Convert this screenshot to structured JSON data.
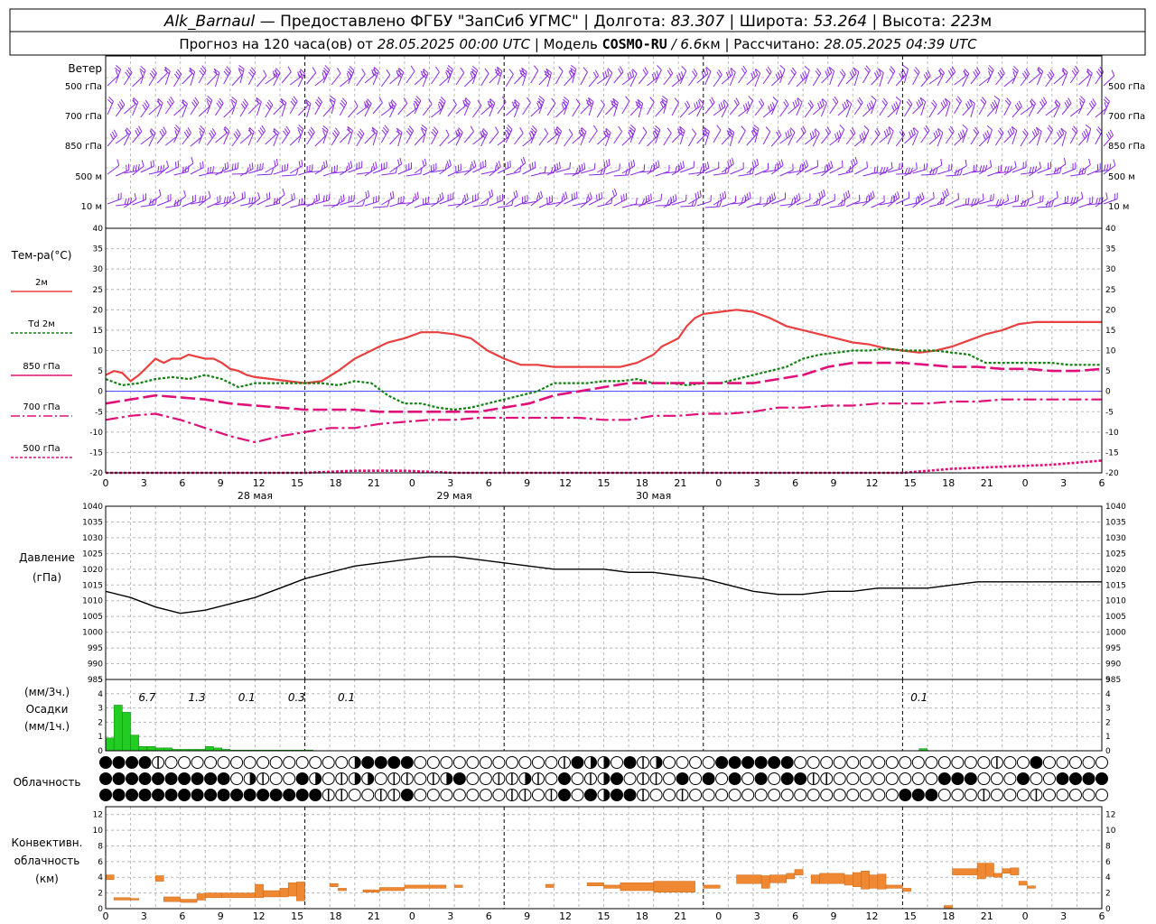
{
  "header": {
    "station": "Alk_Barnaul",
    "line1_rest": " — Предоставлено ФГБУ \"ЗапСиб УГМС\" | Долгота: ",
    "longitude": "83.307",
    "lat_label": " | Широта: ",
    "latitude": "53.264",
    "alt_label": " | Высота: ",
    "altitude": "223",
    "alt_unit": "м",
    "line2_a": "Прогноз на 120 часа(ов) от ",
    "start_time": "28.05.2025 00:00 UTC",
    "line2_b": " | Модель ",
    "model": "COSMO-RU",
    "resolution": " / 6.6",
    "res_unit": "км",
    "line2_c": " | Рассчитано: ",
    "computed": "28.05.2025 04:39 UTC"
  },
  "colors": {
    "t2m": "#e84040",
    "td2m": "#128012",
    "t850": "#e0107a",
    "t700": "#e0107a",
    "t500": "#e0107a",
    "wind": "#8a2be2",
    "pressure": "#000000",
    "precip": "#22cc22",
    "convective": "#ee8833",
    "zero_line": "#4040ff"
  },
  "x_axis": {
    "hour_ticks": [
      "0",
      "3",
      "6",
      "9",
      "12",
      "15",
      "18",
      "21",
      "0",
      "3",
      "6",
      "9",
      "12",
      "15",
      "18",
      "21",
      "0",
      "3",
      "6",
      "9",
      "12",
      "15",
      "18",
      "21",
      "0",
      "3",
      "6"
    ],
    "date_labels": [
      {
        "hour": 42,
        "text": "28 мая"
      },
      {
        "hour": 66,
        "text": "29 мая"
      },
      {
        "hour": 90,
        "text": "30 мая"
      }
    ]
  },
  "wind_panel": {
    "title": "Ветер",
    "levels": [
      "500 гПа",
      "700 гПа",
      "850 гПа",
      "500 м",
      "10 м"
    ]
  },
  "temperature_panel": {
    "title": "Тем-ра(°C)",
    "legend": [
      "2м",
      "Td 2м",
      "850 гПа",
      "700 гПа",
      "500 гПа"
    ],
    "ticks": [
      "40",
      "35",
      "30",
      "25",
      "20",
      "15",
      "10",
      "5",
      "0",
      "-5",
      "-10",
      "-15",
      "-20"
    ]
  },
  "pressure_panel": {
    "title_1": "Давление",
    "title_2": "(гПа)",
    "ticks": [
      "1040",
      "1035",
      "1030",
      "1025",
      "1020",
      "1015",
      "1010",
      "1005",
      "1000",
      "995",
      "990",
      "985"
    ]
  },
  "precip_panel": {
    "title_1": "(мм/3ч.)",
    "title_2": "Осадки",
    "title_3": "(мм/1ч.)",
    "ticks": [
      "5",
      "4",
      "3",
      "2",
      "1",
      "0"
    ],
    "totals": [
      {
        "hour": 29,
        "text": "6.7"
      },
      {
        "hour": 35,
        "text": "1.3"
      },
      {
        "hour": 41,
        "text": "0.1"
      },
      {
        "hour": 47,
        "text": "0.3"
      },
      {
        "hour": 53,
        "text": "0.1"
      },
      {
        "hour": 122,
        "text": "0.1"
      }
    ]
  },
  "cloud_panel": {
    "title": "Облачность"
  },
  "conv_panel": {
    "title_1": "Конвективн.",
    "title_2": "облачность",
    "title_3": "(км)",
    "ticks": [
      "12",
      "10",
      "8",
      "6",
      "4",
      "2",
      "0"
    ]
  },
  "chart_data": [
    {
      "type": "line",
      "title": "Тем-ра(°C)",
      "x_unit": "hours from 27.05 00 UTC",
      "ylim": [
        -20,
        40
      ],
      "series": [
        {
          "name": "2м",
          "x": [
            24,
            25,
            26,
            27,
            28,
            29,
            30,
            31,
            32,
            33,
            34,
            35,
            36,
            37,
            38,
            39,
            40,
            41,
            42,
            44,
            46,
            48,
            50,
            52,
            54,
            56,
            58,
            60,
            62,
            64,
            66,
            68,
            70,
            72,
            74,
            76,
            78,
            80,
            82,
            84,
            86,
            88,
            90,
            91,
            92,
            93,
            94,
            95,
            96,
            98,
            100,
            102,
            104,
            106,
            108,
            110,
            112,
            114,
            116,
            118,
            120,
            122,
            124,
            126,
            128,
            130,
            132,
            134,
            136,
            138,
            140,
            142,
            144
          ],
          "values": [
            4,
            5,
            4.5,
            2.5,
            4,
            6,
            8,
            7,
            8,
            8,
            9,
            8.5,
            8,
            8,
            7,
            5.5,
            5,
            4,
            3.5,
            3,
            2.5,
            2,
            2.5,
            5,
            8,
            10,
            12,
            13,
            14.5,
            14.5,
            14,
            13,
            10,
            8,
            6.5,
            6.5,
            6,
            6,
            6,
            6,
            6,
            7,
            9,
            11,
            12,
            13,
            16,
            18,
            19,
            19.5,
            20,
            19.5,
            18,
            16,
            15,
            14,
            13,
            12,
            11.5,
            10.5,
            10,
            9.5,
            10,
            11,
            12.5,
            14,
            15,
            16.5,
            17,
            17,
            17,
            17,
            17
          ]
        },
        {
          "name": "Td 2м",
          "x": [
            24,
            26,
            28,
            30,
            32,
            34,
            36,
            38,
            40,
            42,
            44,
            46,
            48,
            50,
            52,
            54,
            56,
            58,
            60,
            62,
            64,
            66,
            68,
            70,
            72,
            74,
            76,
            78,
            80,
            82,
            84,
            86,
            88,
            90,
            92,
            94,
            96,
            98,
            100,
            102,
            104,
            106,
            108,
            110,
            112,
            114,
            116,
            118,
            120,
            122,
            124,
            126,
            128,
            130,
            132,
            134,
            136,
            138,
            140,
            142,
            144
          ],
          "values": [
            3,
            1.5,
            2,
            3,
            3.5,
            3,
            4,
            3,
            1,
            2,
            2,
            2,
            2,
            2,
            1.5,
            2.5,
            2,
            -1,
            -3,
            -3,
            -4,
            -4.5,
            -4,
            -3,
            -2,
            -1,
            0,
            2,
            2,
            2,
            2.5,
            2.5,
            3,
            2,
            2,
            1.5,
            2,
            2,
            3,
            4,
            5,
            6,
            8,
            9,
            9.5,
            10,
            10,
            10.5,
            10,
            10,
            10,
            9.5,
            9,
            7,
            7,
            7,
            7,
            7,
            6.5,
            6.5,
            6.5
          ]
        },
        {
          "name": "850 гПа",
          "x": [
            24,
            27,
            30,
            33,
            36,
            39,
            42,
            45,
            48,
            51,
            54,
            57,
            60,
            63,
            66,
            69,
            72,
            75,
            78,
            81,
            84,
            87,
            90,
            93,
            96,
            99,
            102,
            105,
            108,
            111,
            114,
            117,
            120,
            123,
            126,
            129,
            132,
            135,
            138,
            141,
            144
          ],
          "values": [
            -3,
            -2,
            -1,
            -1.5,
            -2,
            -3,
            -3.5,
            -4,
            -4.5,
            -4.5,
            -4.5,
            -5,
            -5,
            -5,
            -5,
            -5,
            -4,
            -3,
            -1,
            0,
            1,
            2,
            2,
            2,
            2,
            2,
            2,
            3,
            4,
            6,
            7,
            7,
            7,
            6.5,
            6,
            6,
            5.5,
            5.5,
            5,
            5,
            5.5
          ]
        },
        {
          "name": "700 гПа",
          "x": [
            24,
            27,
            30,
            33,
            36,
            39,
            42,
            45,
            48,
            51,
            54,
            57,
            60,
            63,
            66,
            69,
            72,
            75,
            78,
            81,
            84,
            87,
            90,
            93,
            96,
            99,
            102,
            105,
            108,
            111,
            114,
            117,
            120,
            123,
            126,
            129,
            132,
            135,
            138,
            141,
            144
          ],
          "values": [
            -7,
            -6,
            -5.5,
            -7,
            -9,
            -11,
            -12.5,
            -11,
            -10,
            -9,
            -9,
            -8,
            -7.5,
            -7,
            -7,
            -6.5,
            -6.5,
            -6.5,
            -6.5,
            -6.5,
            -7,
            -7,
            -6,
            -6,
            -5.5,
            -5.5,
            -5,
            -4,
            -4,
            -3.5,
            -3.5,
            -3,
            -3,
            -3,
            -2.5,
            -2.5,
            -2,
            -2,
            -2,
            -2,
            -2
          ]
        },
        {
          "name": "500 гПа",
          "x": [
            24,
            30,
            36,
            42,
            48,
            54,
            60,
            66,
            72,
            78,
            84,
            90,
            96,
            102,
            108,
            114,
            120,
            126,
            132,
            138,
            144
          ],
          "values": [
            -20,
            -20,
            -20,
            -20,
            -20,
            -19.5,
            -19.5,
            -20,
            -20,
            -20,
            -20,
            -20,
            -20,
            -20,
            -20,
            -20,
            -20,
            -19,
            -18.5,
            -18,
            -17
          ]
        }
      ]
    },
    {
      "type": "line",
      "title": "Давление",
      "ylim": [
        985,
        1040
      ],
      "series": [
        {
          "name": "",
          "x": [
            24,
            27,
            30,
            33,
            36,
            39,
            42,
            45,
            48,
            51,
            54,
            57,
            60,
            63,
            66,
            69,
            72,
            75,
            78,
            81,
            84,
            87,
            90,
            93,
            96,
            99,
            102,
            105,
            108,
            111,
            114,
            117,
            120,
            123,
            126,
            129,
            132,
            135,
            138,
            141,
            144
          ],
          "values": [
            1013,
            1011,
            1008,
            1006,
            1007,
            1009,
            1011,
            1014,
            1017,
            1019,
            1021,
            1022,
            1023,
            1024,
            1024,
            1023,
            1022,
            1021,
            1020,
            1020,
            1020,
            1019,
            1019,
            1018,
            1017,
            1015,
            1013,
            1012,
            1012,
            1013,
            1013,
            1014,
            1014,
            1014,
            1015,
            1016,
            1016,
            1016,
            1016,
            1016,
            1016
          ]
        }
      ]
    },
    {
      "type": "bar",
      "title": "Осадки",
      "ylim": [
        0,
        5
      ],
      "x": [
        24,
        25,
        26,
        27,
        28,
        29,
        30,
        31,
        32,
        33,
        34,
        35,
        36,
        37,
        38,
        39,
        40,
        41,
        42,
        43,
        44,
        45,
        46,
        47,
        48,
        122
      ],
      "values": [
        0.9,
        3.2,
        2.7,
        1.1,
        0.3,
        0.3,
        0.2,
        0.2,
        0.1,
        0.1,
        0.1,
        0.1,
        0.3,
        0.2,
        0.1,
        0.05,
        0.05,
        0.05,
        0.05,
        0.05,
        0.05,
        0.05,
        0.05,
        0.05,
        0.05,
        0.15
      ]
    },
    {
      "type": "bar",
      "title": "Конвективн. облачность",
      "ylim": [
        0,
        13
      ],
      "segments": [
        {
          "start": 24,
          "end": 25,
          "base": 3.7,
          "top": 4.3
        },
        {
          "start": 25,
          "end": 27,
          "base": 1.1,
          "top": 1.4
        },
        {
          "start": 27,
          "end": 28,
          "base": 1.1,
          "top": 1.3
        },
        {
          "start": 30,
          "end": 31,
          "base": 3.5,
          "top": 4.2
        },
        {
          "start": 31,
          "end": 33,
          "base": 0.9,
          "top": 1.5
        },
        {
          "start": 33,
          "end": 35,
          "base": 0.8,
          "top": 1.2
        },
        {
          "start": 35,
          "end": 36,
          "base": 1.1,
          "top": 1.9
        },
        {
          "start": 36,
          "end": 38,
          "base": 1.4,
          "top": 2.0
        },
        {
          "start": 38,
          "end": 42,
          "base": 1.4,
          "top": 2.0
        },
        {
          "start": 42,
          "end": 43,
          "base": 1.4,
          "top": 3.1
        },
        {
          "start": 43,
          "end": 45,
          "base": 1.5,
          "top": 2.3
        },
        {
          "start": 45,
          "end": 46,
          "base": 1.5,
          "top": 2.6
        },
        {
          "start": 46,
          "end": 47,
          "base": 1.6,
          "top": 3.3
        },
        {
          "start": 47,
          "end": 48,
          "base": 1.0,
          "top": 3.4
        },
        {
          "start": 51,
          "end": 52,
          "base": 2.8,
          "top": 3.2
        },
        {
          "start": 52,
          "end": 53,
          "base": 2.3,
          "top": 2.6
        },
        {
          "start": 55,
          "end": 57,
          "base": 2.1,
          "top": 2.4
        },
        {
          "start": 57,
          "end": 60,
          "base": 2.3,
          "top": 2.7
        },
        {
          "start": 60,
          "end": 65,
          "base": 2.6,
          "top": 3.0
        },
        {
          "start": 66,
          "end": 67,
          "base": 2.7,
          "top": 3.0
        },
        {
          "start": 77,
          "end": 78,
          "base": 2.7,
          "top": 3.1
        },
        {
          "start": 82,
          "end": 84,
          "base": 2.9,
          "top": 3.3
        },
        {
          "start": 84,
          "end": 86,
          "base": 2.6,
          "top": 3.0
        },
        {
          "start": 86,
          "end": 90,
          "base": 2.3,
          "top": 3.3
        },
        {
          "start": 90,
          "end": 95,
          "base": 2.1,
          "top": 3.5
        },
        {
          "start": 96,
          "end": 98,
          "base": 2.6,
          "top": 3.0
        },
        {
          "start": 100,
          "end": 103,
          "base": 3.2,
          "top": 4.3
        },
        {
          "start": 103,
          "end": 104,
          "base": 2.6,
          "top": 4.2
        },
        {
          "start": 104,
          "end": 106,
          "base": 3.3,
          "top": 4.3
        },
        {
          "start": 106,
          "end": 107,
          "base": 3.8,
          "top": 4.5
        },
        {
          "start": 107,
          "end": 108,
          "base": 4.3,
          "top": 5.0
        },
        {
          "start": 109,
          "end": 110,
          "base": 3.2,
          "top": 4.3
        },
        {
          "start": 110,
          "end": 113,
          "base": 3.2,
          "top": 4.5
        },
        {
          "start": 113,
          "end": 114,
          "base": 3.0,
          "top": 4.3
        },
        {
          "start": 114,
          "end": 115,
          "base": 2.8,
          "top": 4.6
        },
        {
          "start": 115,
          "end": 116,
          "base": 2.5,
          "top": 4.8
        },
        {
          "start": 116,
          "end": 117,
          "base": 2.6,
          "top": 4.3
        },
        {
          "start": 117,
          "end": 118,
          "base": 2.5,
          "top": 4.4
        },
        {
          "start": 118,
          "end": 120,
          "base": 2.6,
          "top": 3.0
        },
        {
          "start": 120,
          "end": 121,
          "base": 2.2,
          "top": 2.6
        },
        {
          "start": 125,
          "end": 126,
          "base": 0.1,
          "top": 0.4
        },
        {
          "start": 126,
          "end": 129,
          "base": 4.3,
          "top": 5.1
        },
        {
          "start": 129,
          "end": 130,
          "base": 3.8,
          "top": 5.8
        },
        {
          "start": 130,
          "end": 131,
          "base": 4.1,
          "top": 5.8
        },
        {
          "start": 131,
          "end": 132,
          "base": 4.0,
          "top": 4.5
        },
        {
          "start": 132,
          "end": 133,
          "base": 4.5,
          "top": 5.1
        },
        {
          "start": 133,
          "end": 134,
          "base": 4.3,
          "top": 5.2
        },
        {
          "start": 134,
          "end": 135,
          "base": 3.0,
          "top": 3.5
        },
        {
          "start": 135,
          "end": 136,
          "base": 2.6,
          "top": 2.9
        }
      ]
    }
  ]
}
